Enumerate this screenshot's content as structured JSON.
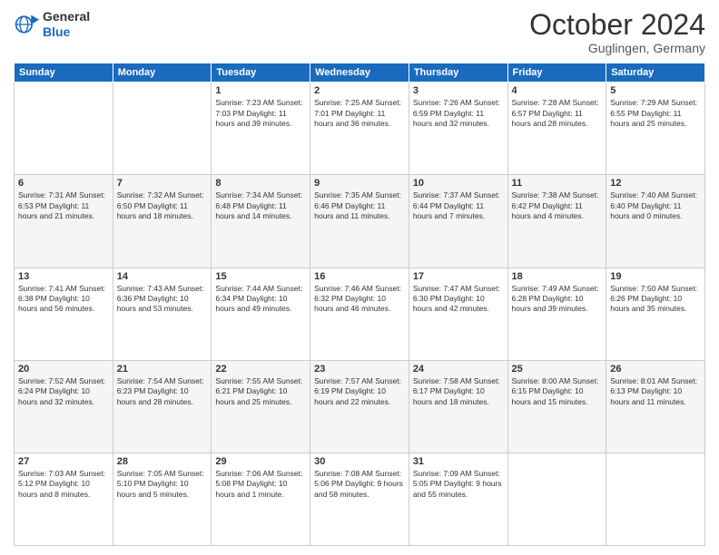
{
  "header": {
    "logo_line1": "General",
    "logo_line2": "Blue",
    "month": "October 2024",
    "location": "Guglingen, Germany"
  },
  "weekdays": [
    "Sunday",
    "Monday",
    "Tuesday",
    "Wednesday",
    "Thursday",
    "Friday",
    "Saturday"
  ],
  "weeks": [
    [
      {
        "day": "",
        "content": ""
      },
      {
        "day": "",
        "content": ""
      },
      {
        "day": "1",
        "content": "Sunrise: 7:23 AM\nSunset: 7:03 PM\nDaylight: 11 hours and 39 minutes."
      },
      {
        "day": "2",
        "content": "Sunrise: 7:25 AM\nSunset: 7:01 PM\nDaylight: 11 hours and 36 minutes."
      },
      {
        "day": "3",
        "content": "Sunrise: 7:26 AM\nSunset: 6:59 PM\nDaylight: 11 hours and 32 minutes."
      },
      {
        "day": "4",
        "content": "Sunrise: 7:28 AM\nSunset: 6:57 PM\nDaylight: 11 hours and 28 minutes."
      },
      {
        "day": "5",
        "content": "Sunrise: 7:29 AM\nSunset: 6:55 PM\nDaylight: 11 hours and 25 minutes."
      }
    ],
    [
      {
        "day": "6",
        "content": "Sunrise: 7:31 AM\nSunset: 6:53 PM\nDaylight: 11 hours and 21 minutes."
      },
      {
        "day": "7",
        "content": "Sunrise: 7:32 AM\nSunset: 6:50 PM\nDaylight: 11 hours and 18 minutes."
      },
      {
        "day": "8",
        "content": "Sunrise: 7:34 AM\nSunset: 6:48 PM\nDaylight: 11 hours and 14 minutes."
      },
      {
        "day": "9",
        "content": "Sunrise: 7:35 AM\nSunset: 6:46 PM\nDaylight: 11 hours and 11 minutes."
      },
      {
        "day": "10",
        "content": "Sunrise: 7:37 AM\nSunset: 6:44 PM\nDaylight: 11 hours and 7 minutes."
      },
      {
        "day": "11",
        "content": "Sunrise: 7:38 AM\nSunset: 6:42 PM\nDaylight: 11 hours and 4 minutes."
      },
      {
        "day": "12",
        "content": "Sunrise: 7:40 AM\nSunset: 6:40 PM\nDaylight: 11 hours and 0 minutes."
      }
    ],
    [
      {
        "day": "13",
        "content": "Sunrise: 7:41 AM\nSunset: 6:38 PM\nDaylight: 10 hours and 56 minutes."
      },
      {
        "day": "14",
        "content": "Sunrise: 7:43 AM\nSunset: 6:36 PM\nDaylight: 10 hours and 53 minutes."
      },
      {
        "day": "15",
        "content": "Sunrise: 7:44 AM\nSunset: 6:34 PM\nDaylight: 10 hours and 49 minutes."
      },
      {
        "day": "16",
        "content": "Sunrise: 7:46 AM\nSunset: 6:32 PM\nDaylight: 10 hours and 46 minutes."
      },
      {
        "day": "17",
        "content": "Sunrise: 7:47 AM\nSunset: 6:30 PM\nDaylight: 10 hours and 42 minutes."
      },
      {
        "day": "18",
        "content": "Sunrise: 7:49 AM\nSunset: 6:28 PM\nDaylight: 10 hours and 39 minutes."
      },
      {
        "day": "19",
        "content": "Sunrise: 7:50 AM\nSunset: 6:26 PM\nDaylight: 10 hours and 35 minutes."
      }
    ],
    [
      {
        "day": "20",
        "content": "Sunrise: 7:52 AM\nSunset: 6:24 PM\nDaylight: 10 hours and 32 minutes."
      },
      {
        "day": "21",
        "content": "Sunrise: 7:54 AM\nSunset: 6:23 PM\nDaylight: 10 hours and 28 minutes."
      },
      {
        "day": "22",
        "content": "Sunrise: 7:55 AM\nSunset: 6:21 PM\nDaylight: 10 hours and 25 minutes."
      },
      {
        "day": "23",
        "content": "Sunrise: 7:57 AM\nSunset: 6:19 PM\nDaylight: 10 hours and 22 minutes."
      },
      {
        "day": "24",
        "content": "Sunrise: 7:58 AM\nSunset: 6:17 PM\nDaylight: 10 hours and 18 minutes."
      },
      {
        "day": "25",
        "content": "Sunrise: 8:00 AM\nSunset: 6:15 PM\nDaylight: 10 hours and 15 minutes."
      },
      {
        "day": "26",
        "content": "Sunrise: 8:01 AM\nSunset: 6:13 PM\nDaylight: 10 hours and 11 minutes."
      }
    ],
    [
      {
        "day": "27",
        "content": "Sunrise: 7:03 AM\nSunset: 5:12 PM\nDaylight: 10 hours and 8 minutes."
      },
      {
        "day": "28",
        "content": "Sunrise: 7:05 AM\nSunset: 5:10 PM\nDaylight: 10 hours and 5 minutes."
      },
      {
        "day": "29",
        "content": "Sunrise: 7:06 AM\nSunset: 5:08 PM\nDaylight: 10 hours and 1 minute."
      },
      {
        "day": "30",
        "content": "Sunrise: 7:08 AM\nSunset: 5:06 PM\nDaylight: 9 hours and 58 minutes."
      },
      {
        "day": "31",
        "content": "Sunrise: 7:09 AM\nSunset: 5:05 PM\nDaylight: 9 hours and 55 minutes."
      },
      {
        "day": "",
        "content": ""
      },
      {
        "day": "",
        "content": ""
      }
    ]
  ]
}
